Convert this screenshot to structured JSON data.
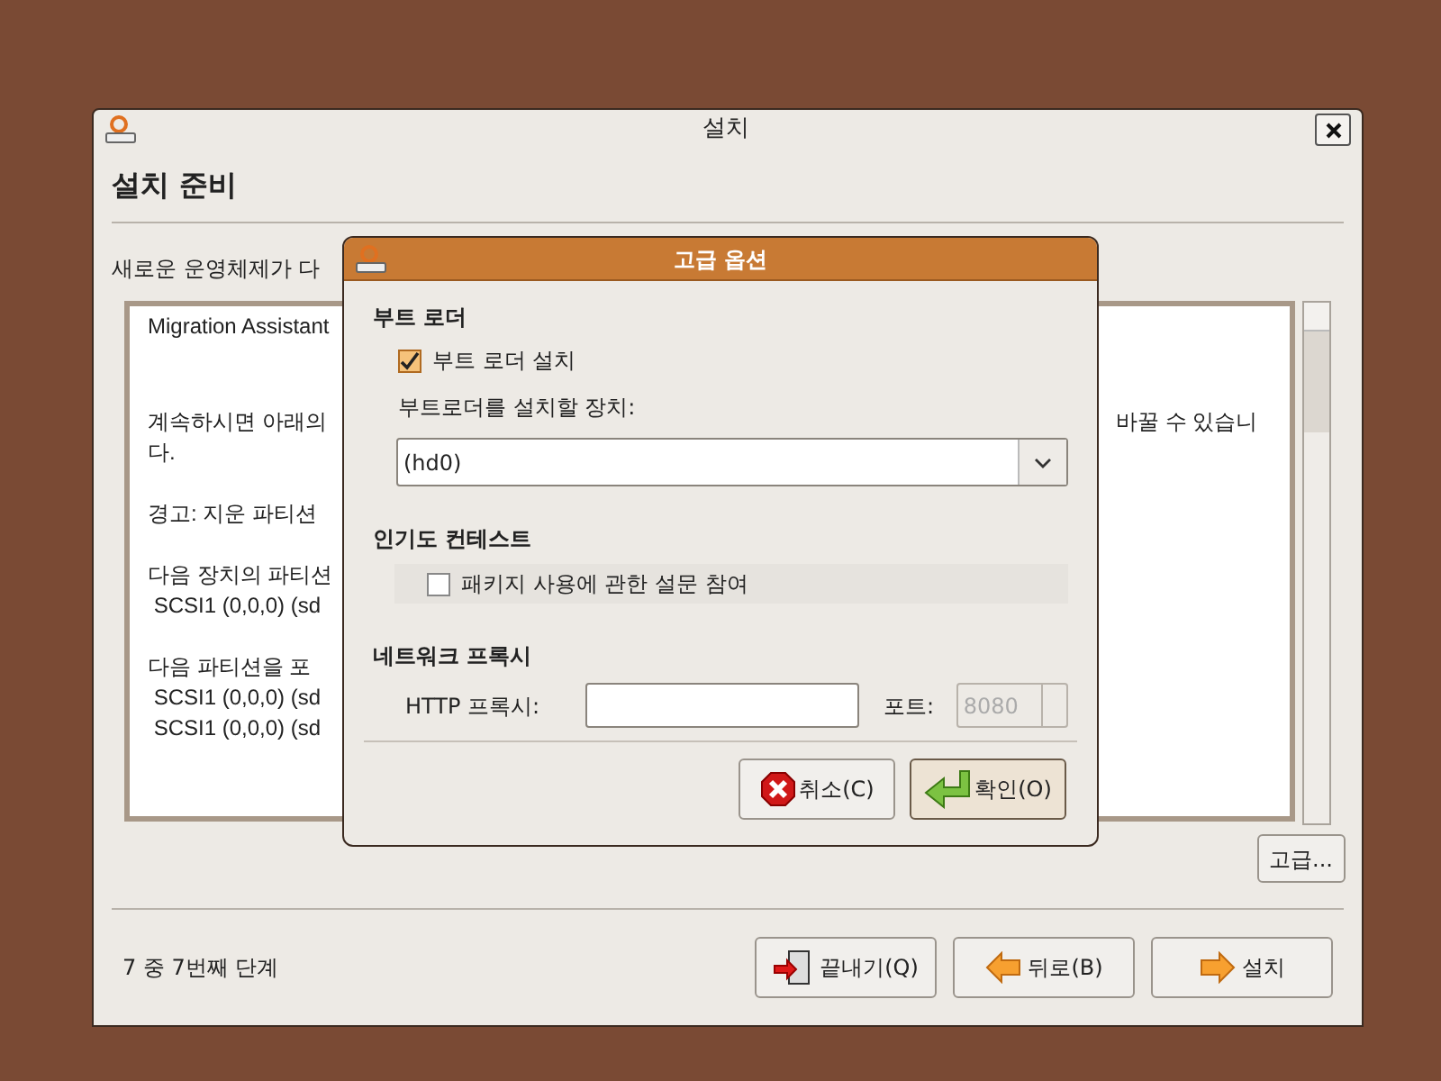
{
  "window": {
    "title": "설치",
    "heading": "설치 준비",
    "intro": "새로운 운영체제가 다"
  },
  "summary_paragraphs": [
    {
      "lines": [
        {
          "left": "Migration Assistant"
        }
      ]
    },
    {
      "lines": [
        {
          "left": "계속하시면 아래의",
          "right": "바꿀 수 있습니"
        },
        {
          "left": "다."
        }
      ]
    },
    {
      "lines": [
        {
          "left": "경고: 지운 파티션"
        }
      ]
    },
    {
      "lines": [
        {
          "left": "다음 장치의 파티션"
        },
        {
          "left": " SCSI1 (0,0,0) (sd"
        }
      ]
    },
    {
      "lines": [
        {
          "left": "다음 파티션을 포"
        },
        {
          "left": " SCSI1 (0,0,0) (sd"
        },
        {
          "left": " SCSI1 (0,0,0) (sd"
        }
      ]
    }
  ],
  "advanced_button": "고급...",
  "footer": {
    "step": "7 중 7번째 단계",
    "buttons": [
      {
        "kind": "quit",
        "label": "끝내기(Q)"
      },
      {
        "kind": "back",
        "label": "뒤로(B)"
      },
      {
        "kind": "forward",
        "label": "설치"
      }
    ]
  },
  "dialog": {
    "title": "고급 옵션",
    "bootloader": {
      "heading": "부트 로더",
      "checkbox": {
        "label": "부트 로더 설치",
        "checked": true
      },
      "device_label": "부트로더를 설치할 장치:",
      "device_value": "(hd0)"
    },
    "popcon": {
      "heading": "인기도 컨테스트",
      "checkbox": {
        "label": "패키지 사용에 관한 설문 참여",
        "checked": false
      }
    },
    "proxy": {
      "heading": "네트워크 프록시",
      "http_label": "HTTP 프록시:",
      "port_label": "포트:",
      "port_placeholder": "8080"
    },
    "buttons": [
      {
        "kind": "cancel",
        "label": "취소(C)"
      },
      {
        "kind": "ok",
        "label": "확인(O)"
      }
    ]
  }
}
